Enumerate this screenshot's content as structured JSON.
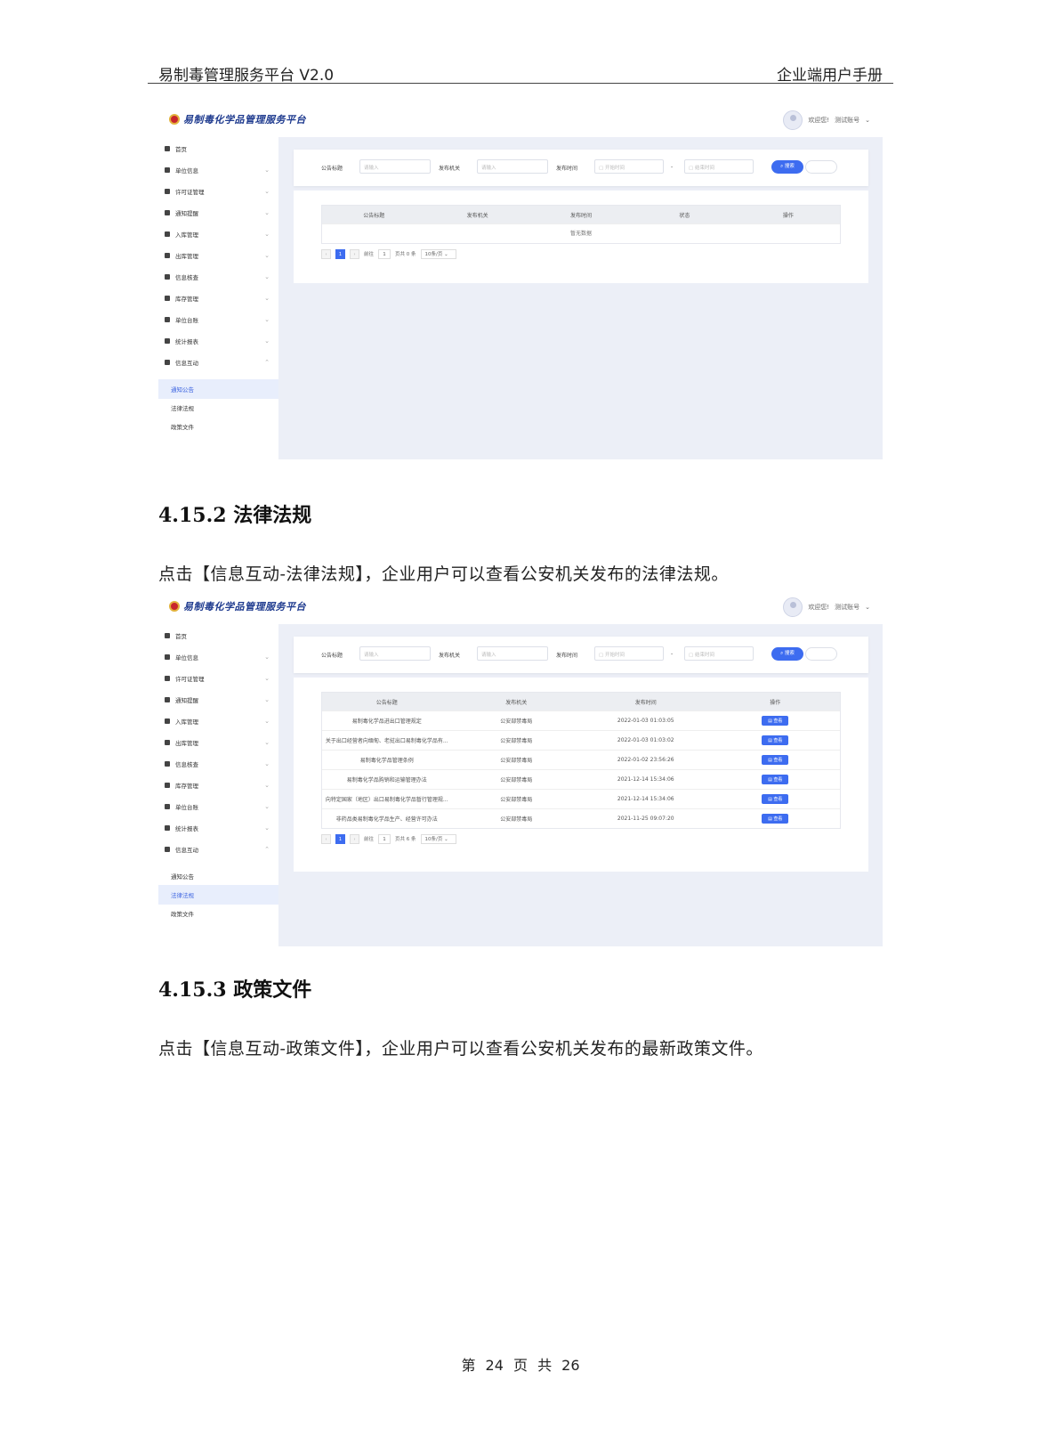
{
  "header": {
    "left": "易制毒管理服务平台 V2.0",
    "right": "企业端用户手册"
  },
  "app": {
    "logo_text": "易制毒化学品管理服务平台",
    "user_greeting": "欢迎您!",
    "user_name": "测试账号",
    "menu": [
      "首页",
      "单位信息",
      "许可证管理",
      "通知提醒",
      "入库管理",
      "出库管理",
      "信息核查",
      "库存管理",
      "单位台账",
      "统计报表",
      "信息互动"
    ],
    "submenu": [
      "通知公告",
      "法律法规",
      "政策文件"
    ],
    "filter": {
      "title_label": "公告标题",
      "org_label": "发布机关",
      "time_label": "发布时间",
      "placeholder": "请输入",
      "start_placeholder": "开始时间",
      "end_placeholder": "结束时间",
      "dash": "-",
      "search_label": "搜索"
    }
  },
  "screenshot1": {
    "active_submenu": "通知公告",
    "columns": [
      "公告标题",
      "发布机关",
      "发布时间",
      "状态",
      "操作"
    ],
    "empty_text": "暂无数据",
    "pager": {
      "page": "1",
      "goto": "前往",
      "page_input": "1",
      "total": "页共 0 条",
      "size": "10条/页"
    }
  },
  "section1": {
    "heading": "4.15.2 法律法规",
    "text": "点击【信息互动-法律法规】，企业用户可以查看公安机关发布的法律法规。"
  },
  "screenshot2": {
    "active_submenu": "法律法规",
    "columns": [
      "公告标题",
      "发布机关",
      "发布时间",
      "操作"
    ],
    "rows": [
      {
        "title": "易制毒化学品进出口管理规定",
        "org": "公安部禁毒局",
        "time": "2022-01-03 01:03:05"
      },
      {
        "title": "关于出口经营者向缅甸、老挝出口易制毒化学品有...",
        "org": "公安部禁毒局",
        "time": "2022-01-03 01:03:02"
      },
      {
        "title": "易制毒化学品管理条例",
        "org": "公安部禁毒局",
        "time": "2022-01-02 23:56:26"
      },
      {
        "title": "易制毒化学品购销和运输管理办法",
        "org": "公安部禁毒局",
        "time": "2021-12-14 15:34:06"
      },
      {
        "title": "向特定国家（地区）出口易制毒化学品暂行管理规...",
        "org": "公安部禁毒局",
        "time": "2021-12-14 15:34:06"
      },
      {
        "title": "非药品类易制毒化学品生产、经营许可办法",
        "org": "公安部禁毒局",
        "time": "2021-11-25 09:07:20"
      }
    ],
    "view_label": "查看",
    "pager": {
      "page": "1",
      "goto": "前往",
      "page_input": "1",
      "total": "页共 6 条",
      "size": "10条/页"
    }
  },
  "section2": {
    "heading": "4.15.3 政策文件",
    "text": "点击【信息互动-政策文件】，企业用户可以查看公安机关发布的最新政策文件。"
  },
  "footer": {
    "text": "第 24 页 共 26"
  }
}
